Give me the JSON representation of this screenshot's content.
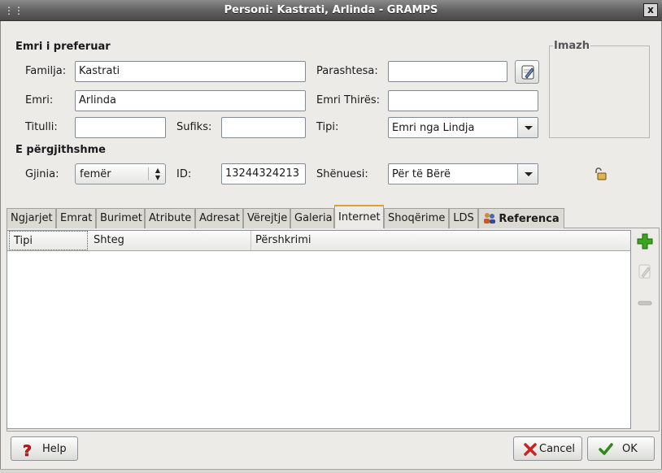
{
  "window": {
    "title": "Personi: Kastrati, Arlinda - GRAMPS",
    "close_label": "x"
  },
  "preferred_name": {
    "heading": "Emri i preferuar",
    "family_label": "Familja:",
    "family_value": "Kastrati",
    "prefix_label": "Parashtesa:",
    "prefix_value": "",
    "given_label": "Emri:",
    "given_value": "Arlinda",
    "callname_label": "Emri Thirës:",
    "callname_value": "",
    "title_label": "Titulli:",
    "title_value": "",
    "suffix_label": "Sufiks:",
    "suffix_value": "",
    "type_label": "Tipi:",
    "type_value": "Emri nga Lindja"
  },
  "image_frame": {
    "label": "Imazh"
  },
  "general": {
    "heading": "E përgjithshme",
    "gender_label": "Gjinia:",
    "gender_value": "femër",
    "id_label": "ID:",
    "id_value": "13244324213",
    "marker_label": "Shënuesi:",
    "marker_value": "Për të Bërë"
  },
  "tabs": [
    {
      "label": "Ngjarjet"
    },
    {
      "label": "Emrat"
    },
    {
      "label": "Burimet"
    },
    {
      "label": "Atribute"
    },
    {
      "label": "Adresat"
    },
    {
      "label": "Vërejtje"
    },
    {
      "label": "Galeria"
    },
    {
      "label": "Internet"
    },
    {
      "label": "Shoqërime"
    },
    {
      "label": "LDS"
    },
    {
      "label": "Referenca"
    }
  ],
  "active_tab": "Internet",
  "list": {
    "columns": [
      "Tipi",
      "Shteg",
      "Përshkrimi"
    ],
    "rows": []
  },
  "buttons": {
    "help": "Help",
    "cancel": "Cancel",
    "ok": "OK"
  },
  "colors": {
    "titlebar": "#5e5e5e",
    "add_green": "#2f9e1a",
    "cancel_red": "#cc2222",
    "ok_green": "#2f8a1a"
  }
}
